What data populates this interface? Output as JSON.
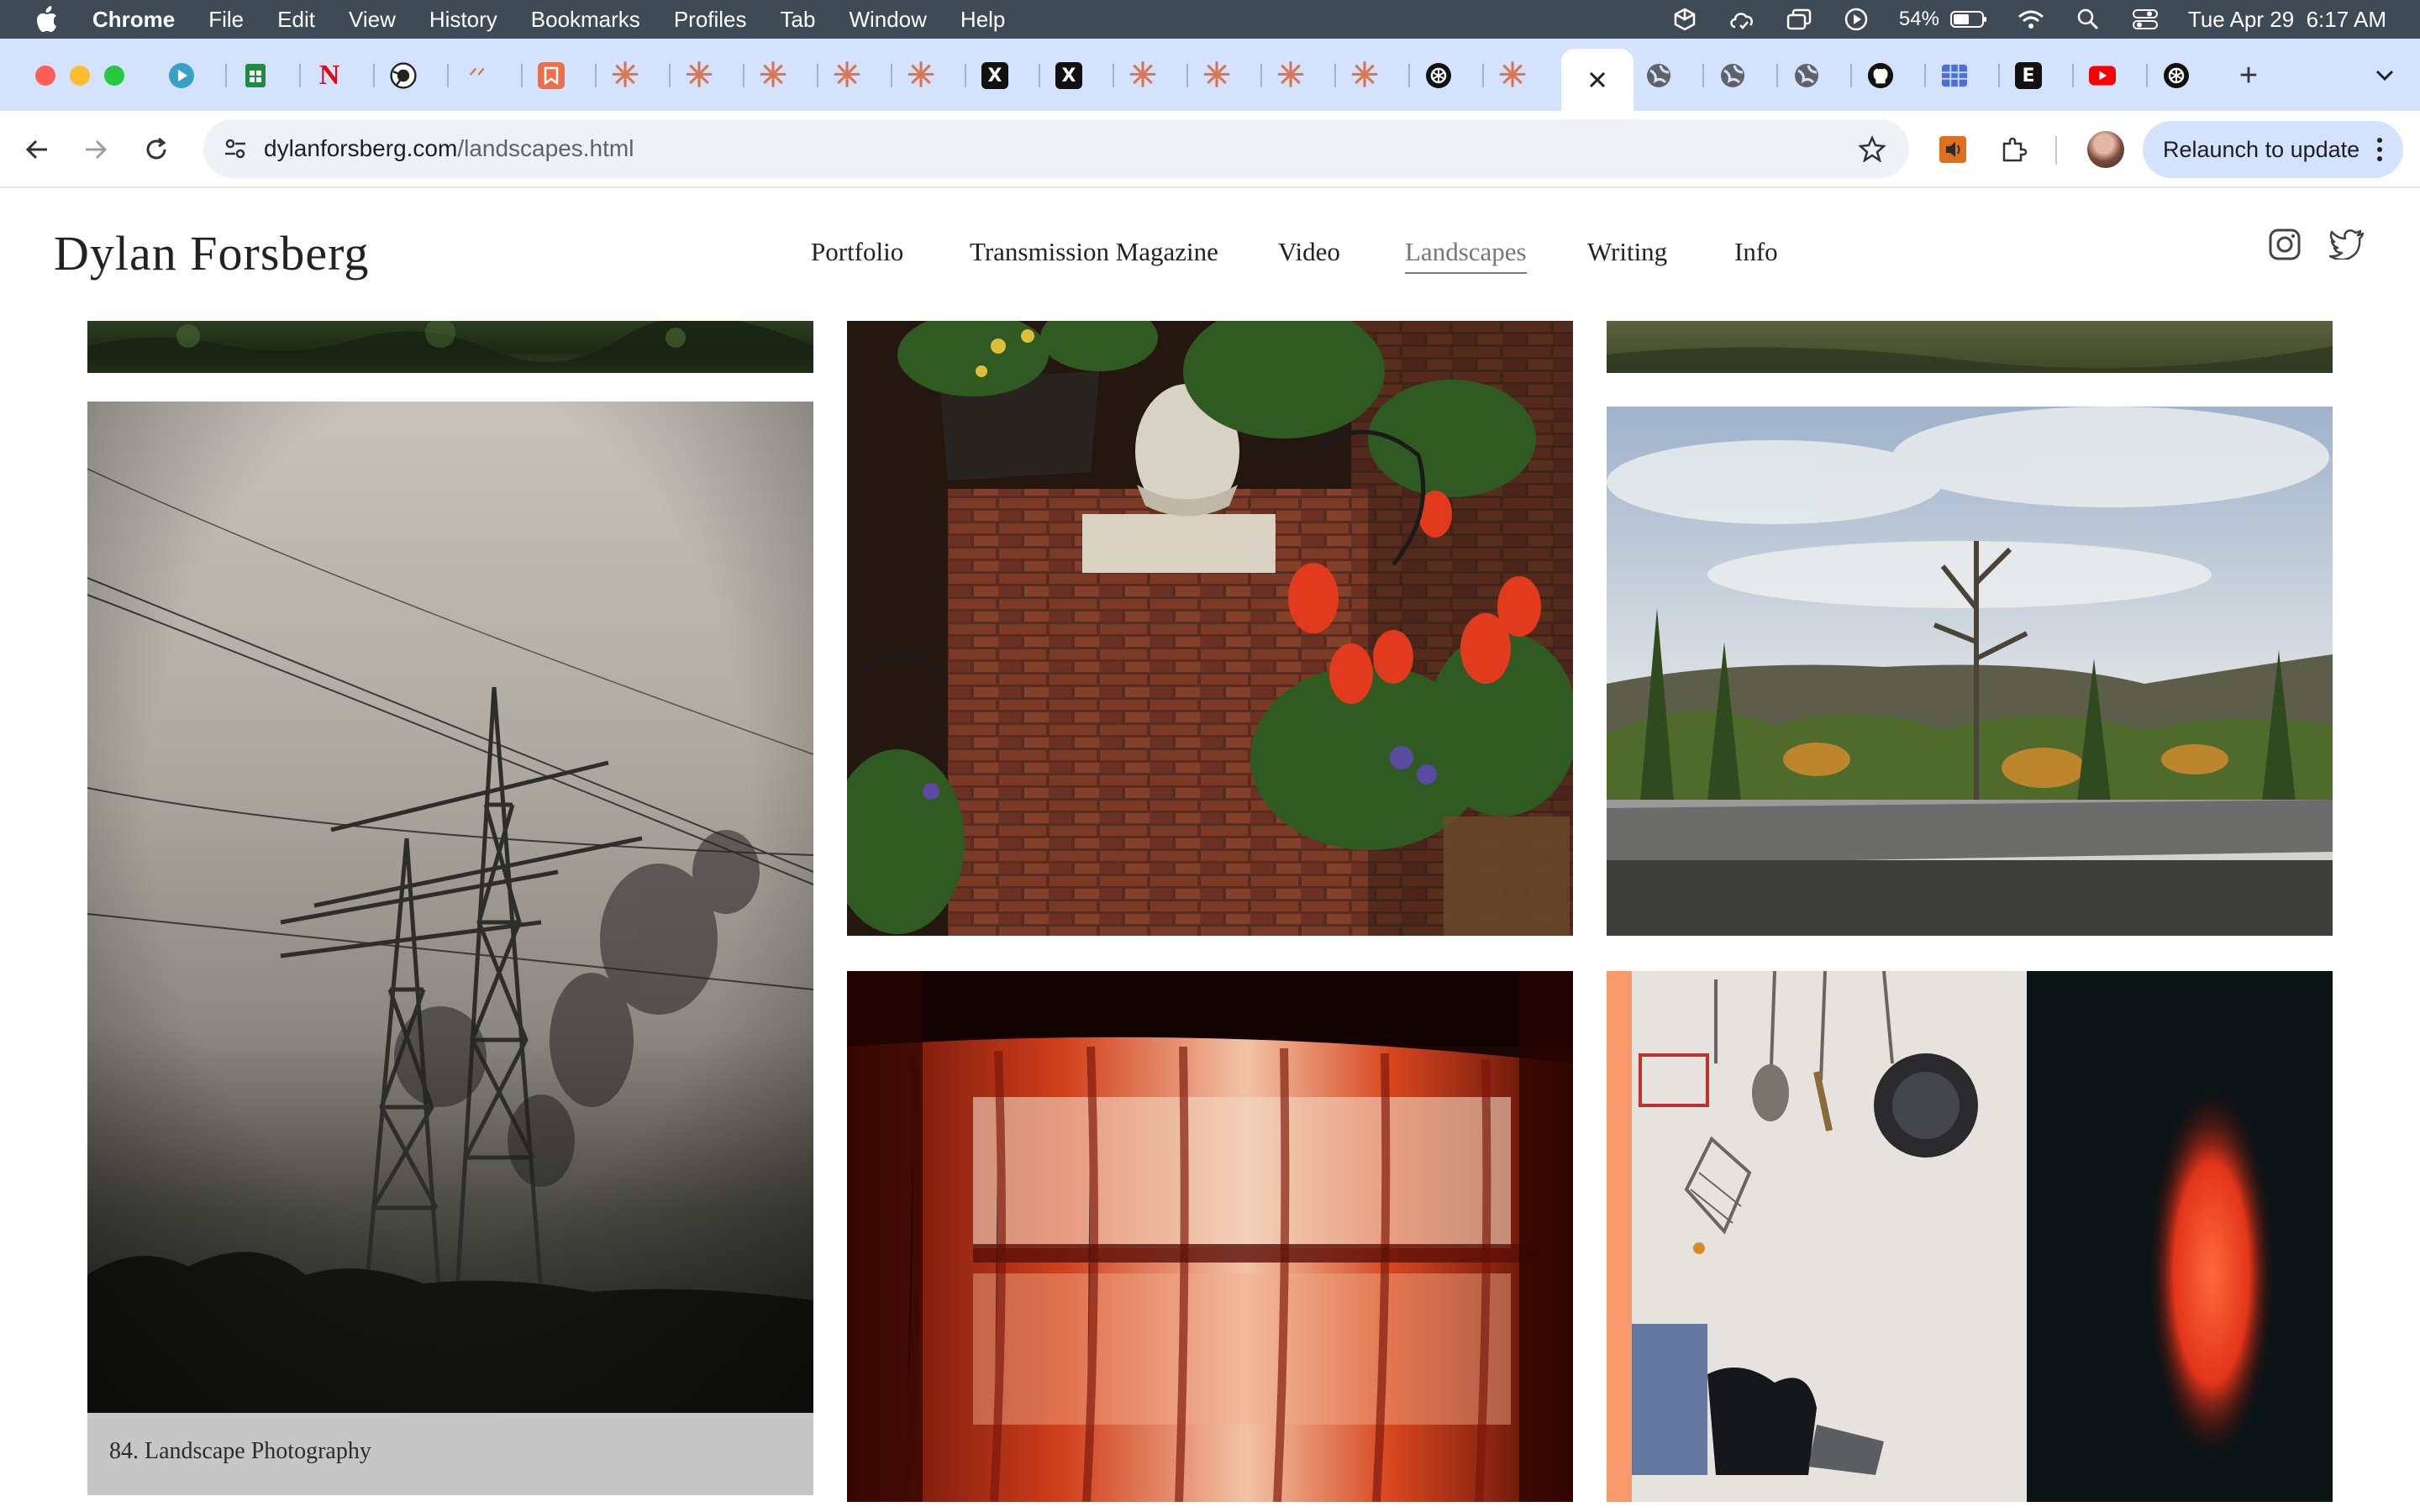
{
  "menubar": {
    "app_name": "Chrome",
    "menus": [
      "File",
      "Edit",
      "View",
      "History",
      "Bookmarks",
      "Profiles",
      "Tab",
      "Window",
      "Help"
    ],
    "battery_percent": "54%",
    "datetime": "Tue Apr 29  6:17 AM"
  },
  "browser": {
    "url_domain": "dylanforsberg.com",
    "url_path": "/landscapes.html",
    "relaunch_label": "Relaunch to update",
    "tab_favicons": [
      "play-icon",
      "sheets-icon",
      "netflix-icon",
      "camera-icon",
      "claude-icon",
      "bookmark-app-icon",
      "claude-icon",
      "claude-icon",
      "claude-icon",
      "claude-icon",
      "claude-icon",
      "x-icon",
      "x-icon",
      "claude-icon",
      "claude-icon",
      "claude-icon",
      "claude-icon",
      "openai-icon",
      "claude-icon",
      "close-icon",
      "globe-icon",
      "globe-icon",
      "globe-icon",
      "github-icon",
      "grid-icon",
      "e-icon",
      "youtube-icon",
      "openai-icon"
    ]
  },
  "site": {
    "title": "Dylan Forsberg",
    "nav": [
      {
        "label": "Portfolio",
        "active": false
      },
      {
        "label": "Transmission Magazine",
        "active": false
      },
      {
        "label": "Video",
        "active": false
      },
      {
        "label": "Landscapes",
        "active": true
      },
      {
        "label": "Writing",
        "active": false
      },
      {
        "label": "Info",
        "active": false
      }
    ]
  },
  "gallery": {
    "caption": "84. Landscape Photography",
    "photos": [
      "power-lines-photo",
      "flowers-on-brick-wall-photo",
      "forest-roadside-photo",
      "red-curtains-photo",
      "kitchen-utensils-photo"
    ]
  },
  "colors": {
    "menubar": "#3f4a57",
    "tabstrip": "#d3e3fd",
    "accent": "#d97757"
  }
}
